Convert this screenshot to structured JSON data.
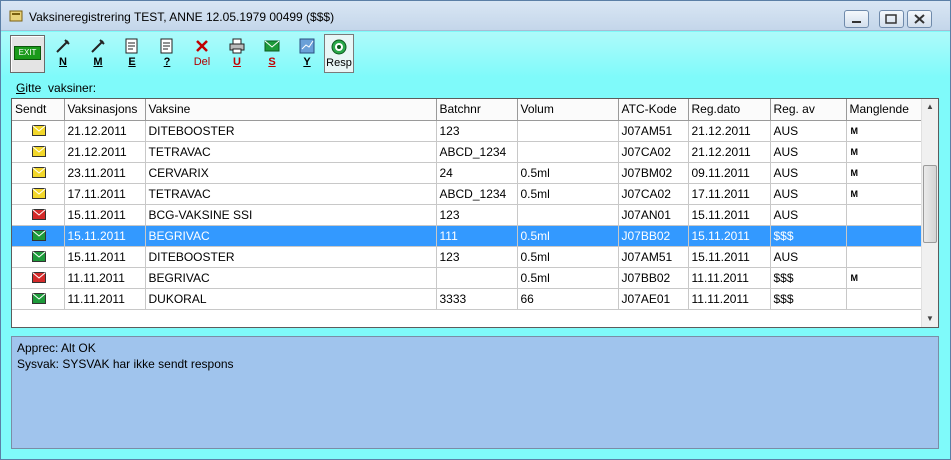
{
  "window": {
    "title": "Vaksineregistrering TEST, ANNE 12.05.1979 00499 ($$$)"
  },
  "toolbar": {
    "exit_label": "EXIT",
    "buttons": [
      {
        "label": "N",
        "icon": "syringe-icon"
      },
      {
        "label": "M",
        "icon": "syringe-icon"
      },
      {
        "label": "E",
        "icon": "document-edit-icon"
      },
      {
        "label": "?",
        "icon": "document-help-icon"
      },
      {
        "label": "Del",
        "icon": "delete-x-icon"
      },
      {
        "label": "U",
        "icon": "printer-icon"
      },
      {
        "label": "S",
        "icon": "send-envelope-icon"
      },
      {
        "label": "Y",
        "icon": "chart-icon"
      }
    ],
    "resp_label": "Resp"
  },
  "section_label": {
    "u": "G",
    "rest": "itte  vaksiner:"
  },
  "table": {
    "columns": [
      "Sendt",
      "Vaksinasjons",
      "Vaksine",
      "Batchnr",
      "Volum",
      "ATC-Kode",
      "Reg.dato",
      "Reg. av",
      "Manglende"
    ],
    "rows": [
      {
        "status": "yellow",
        "date": "21.12.2011",
        "vaccine": "DITEBOOSTER",
        "batch": "123",
        "volume": "",
        "atc": "J07AM51",
        "reg_date": "21.12.2011",
        "reg_by": "AUS",
        "missing": "M"
      },
      {
        "status": "yellow",
        "date": "21.12.2011",
        "vaccine": "TETRAVAC",
        "batch": "ABCD_1234",
        "volume": "",
        "atc": "J07CA02",
        "reg_date": "21.12.2011",
        "reg_by": "AUS",
        "missing": "M"
      },
      {
        "status": "yellow",
        "date": "23.11.2011",
        "vaccine": "CERVARIX",
        "batch": "24",
        "volume": "0.5ml",
        "atc": "J07BM02",
        "reg_date": "09.11.2011",
        "reg_by": "AUS",
        "missing": "M"
      },
      {
        "status": "yellow",
        "date": "17.11.2011",
        "vaccine": "TETRAVAC",
        "batch": "ABCD_1234",
        "volume": "0.5ml",
        "atc": "J07CA02",
        "reg_date": "17.11.2011",
        "reg_by": "AUS",
        "missing": "M"
      },
      {
        "status": "red",
        "date": "15.11.2011",
        "vaccine": "BCG-VAKSINE SSI",
        "batch": "123",
        "volume": "",
        "atc": "J07AN01",
        "reg_date": "15.11.2011",
        "reg_by": "AUS",
        "missing": ""
      },
      {
        "status": "green",
        "date": "15.11.2011",
        "vaccine": "BEGRIVAC",
        "batch": "111",
        "volume": "0.5ml",
        "atc": "J07BB02",
        "reg_date": "15.11.2011",
        "reg_by": "$$$",
        "missing": "",
        "selected": true
      },
      {
        "status": "green",
        "date": "15.11.2011",
        "vaccine": "DITEBOOSTER",
        "batch": "123",
        "volume": "0.5ml",
        "atc": "J07AM51",
        "reg_date": "15.11.2011",
        "reg_by": "AUS",
        "missing": ""
      },
      {
        "status": "red",
        "date": "11.11.2011",
        "vaccine": "BEGRIVAC",
        "batch": "",
        "volume": "0.5ml",
        "atc": "J07BB02",
        "reg_date": "11.11.2011",
        "reg_by": "$$$",
        "missing": "M"
      },
      {
        "status": "green",
        "date": "11.11.2011",
        "vaccine": "DUKORAL",
        "batch": "3333",
        "volume": "66",
        "atc": "J07AE01",
        "reg_date": "11.11.2011",
        "reg_by": "$$$",
        "missing": ""
      }
    ]
  },
  "status_panel": {
    "lines": [
      "Apprec: Alt OK",
      "Sysvak: SYSVAK har ikke sendt respons"
    ]
  },
  "colors": {
    "toolbar_bg": "#7ffafa",
    "selection": "#3399ff",
    "status_bg": "#a0c4ed",
    "envelope_yellow": "#f2d72a",
    "envelope_red": "#d42a2a",
    "envelope_green": "#1d9a3a"
  }
}
